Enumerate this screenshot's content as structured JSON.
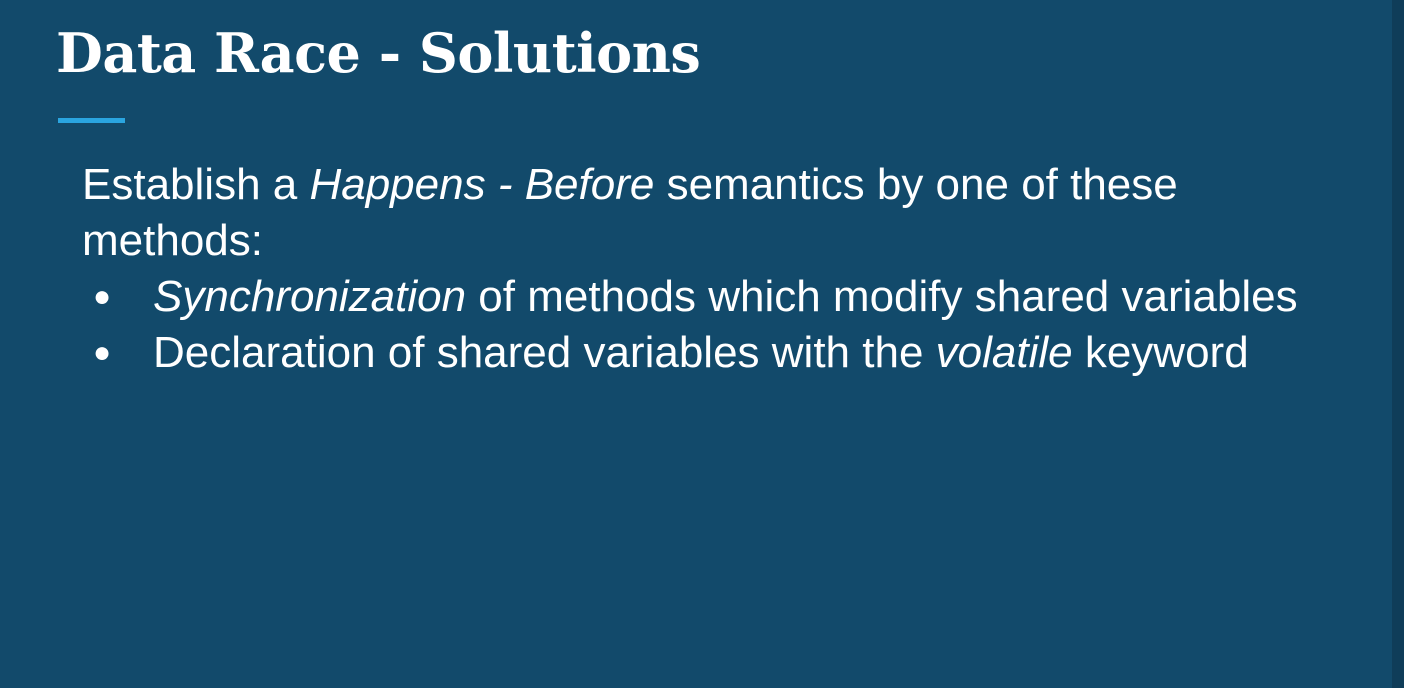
{
  "slide": {
    "title": "Data Race - Solutions",
    "intro": {
      "part1": "Establish a ",
      "em1": "Happens - Before",
      "part2": " semantics by one of these methods:"
    },
    "bullets": [
      {
        "before": "",
        "em": "Synchronization",
        "after": " of methods which modify shared variables"
      },
      {
        "before": "Declaration of shared variables with the ",
        "em": "volatile",
        "after": " keyword"
      }
    ],
    "bullet_glyph": "●"
  },
  "colors": {
    "background": "#124a6b",
    "accent": "#2aa5e0",
    "text": "#ffffff"
  }
}
